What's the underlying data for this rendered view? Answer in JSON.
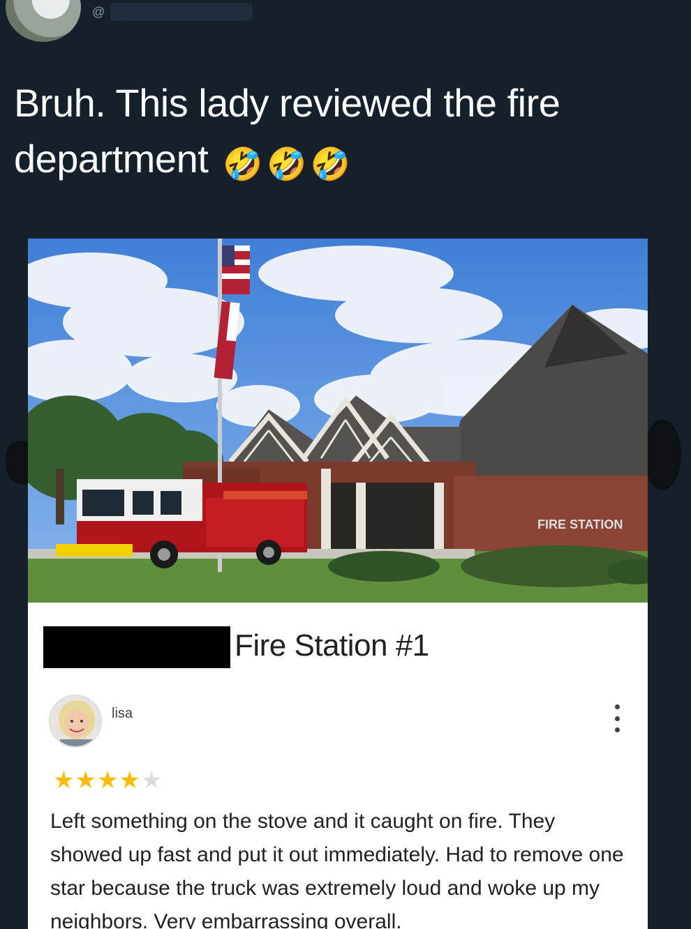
{
  "tweet": {
    "handle_prefix": "@",
    "text": "Bruh. This lady reviewed the fire department",
    "emoji": "🤣",
    "emoji_count": 3
  },
  "card": {
    "photo_sign": "FIRE STATION",
    "place_title": "Fire Station #1",
    "review": {
      "reviewer_name": "lisa",
      "rating": 4,
      "max_rating": 5,
      "text": "Left something on the stove and it caught on fire. They showed up fast and put it out immediately. Had to remove one star because the truck was extremely loud and woke up my neighbors. Very embarrassing overall."
    }
  },
  "colors": {
    "background": "#15202b",
    "star_filled": "#fbbc04",
    "star_empty": "#dadce0",
    "truck_red": "#b0151c"
  }
}
